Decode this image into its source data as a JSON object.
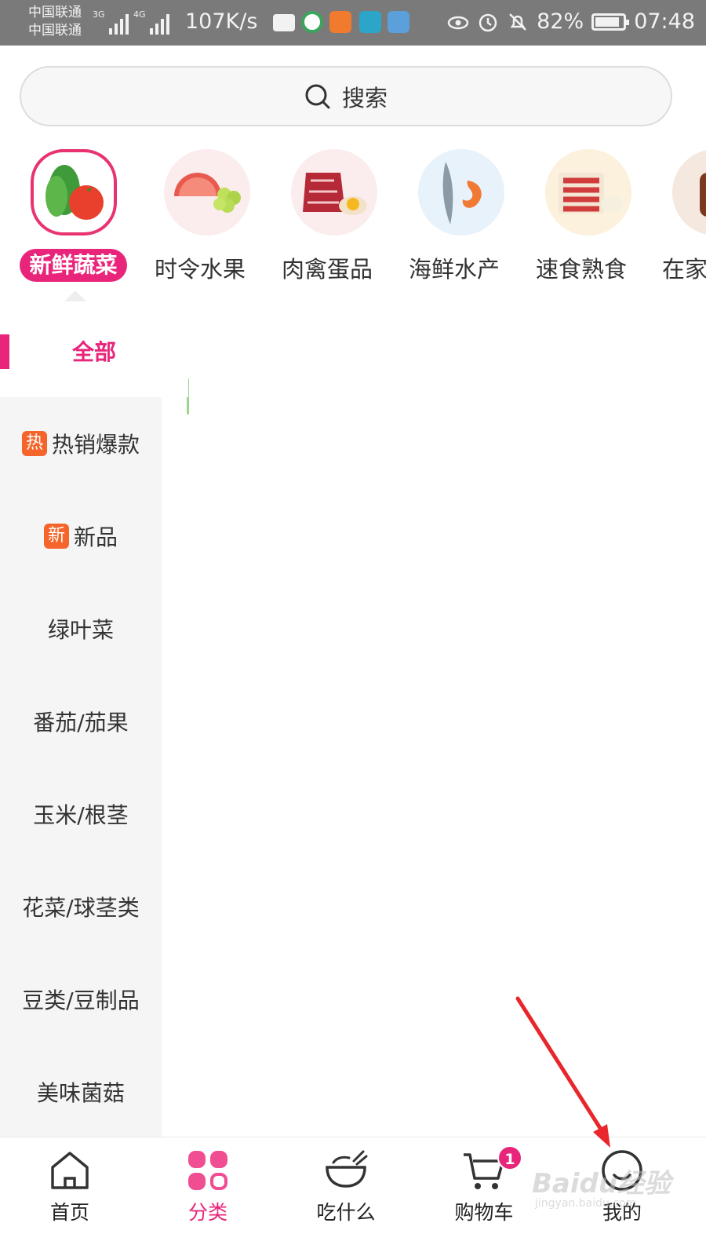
{
  "status_bar": {
    "carrier_1": "中国联通",
    "carrier_2": "中国联通",
    "network_1": "3G",
    "network_2": "4G",
    "speed": "107K/s",
    "battery": "82%",
    "time": "07:48"
  },
  "search": {
    "label": "搜索"
  },
  "categories": [
    {
      "label": "新鲜蔬菜",
      "selected": true
    },
    {
      "label": "时令水果",
      "selected": false
    },
    {
      "label": "肉禽蛋品",
      "selected": false
    },
    {
      "label": "海鲜水产",
      "selected": false
    },
    {
      "label": "速食熟食",
      "selected": false
    },
    {
      "label": "在家",
      "selected": false
    }
  ],
  "sidebar": {
    "items": [
      {
        "label": "全部",
        "tag": ""
      },
      {
        "label": "热销爆款",
        "tag": "热"
      },
      {
        "label": "新品",
        "tag": "新"
      },
      {
        "label": "绿叶菜",
        "tag": ""
      },
      {
        "label": "番茄/茄果",
        "tag": ""
      },
      {
        "label": "玉米/根茎",
        "tag": ""
      },
      {
        "label": "花菜/球茎类",
        "tag": ""
      },
      {
        "label": "豆类/豆制品",
        "tag": ""
      },
      {
        "label": "美味菌菇",
        "tag": ""
      }
    ]
  },
  "tabbar": {
    "items": [
      {
        "label": "首页",
        "icon": "home-icon"
      },
      {
        "label": "分类",
        "icon": "category-icon"
      },
      {
        "label": "吃什么",
        "icon": "bowl-icon"
      },
      {
        "label": "购物车",
        "icon": "cart-icon",
        "badge": "1"
      },
      {
        "label": "我的",
        "icon": "profile-icon"
      }
    ]
  },
  "watermark": {
    "brand": "Baidu经验",
    "url": "jingyan.baidu.com"
  },
  "colors": {
    "accent": "#e8257a",
    "tag": "#f5642a",
    "status_bar": "#7a7a7a"
  }
}
